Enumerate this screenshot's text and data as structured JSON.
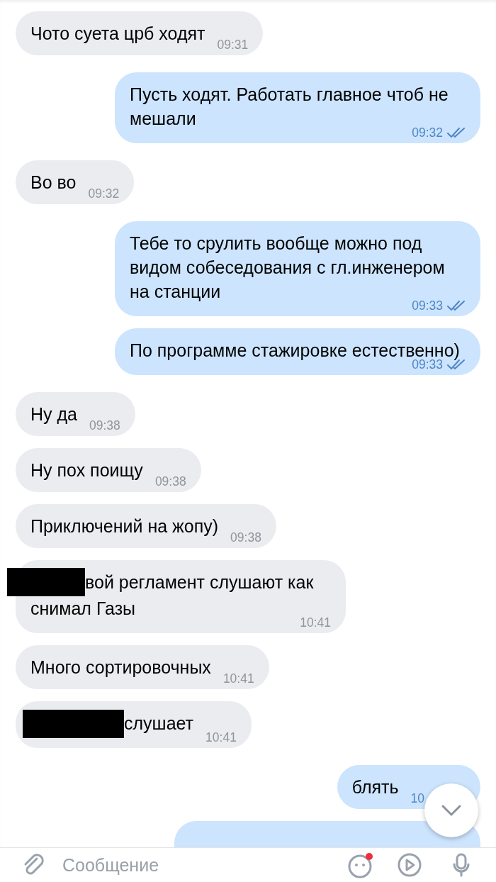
{
  "messages": [
    {
      "outgoing": false,
      "text": "Чото суета црб ходят",
      "time": "09:31"
    },
    {
      "outgoing": true,
      "text": "Пусть ходят. Работать главное чтоб не мешали",
      "time": "09:32",
      "read": true
    },
    {
      "outgoing": false,
      "text": "Во во",
      "time": "09:32"
    },
    {
      "outgoing": true,
      "text": "Тебе то срулить вообще можно под видом собеседования с гл.инженером на станции",
      "time": "09:33",
      "read": true
    },
    {
      "outgoing": true,
      "text": "По программе стажировке естественно)",
      "time": "09:33",
      "read": true
    },
    {
      "outgoing": false,
      "text": "Ну да",
      "time": "09:38"
    },
    {
      "outgoing": false,
      "text": "Ну пох поищу",
      "time": "09:38"
    },
    {
      "outgoing": false,
      "text": "Приключений на жопу)",
      "time": "09:38"
    },
    {
      "outgoing": false,
      "text": "вой регламент слушают как снимал Газы",
      "time": "10:41",
      "redacted": true
    },
    {
      "outgoing": false,
      "text": "Много сортировочных",
      "time": "10:41"
    },
    {
      "outgoing": false,
      "text": "слушает",
      "time": "10:41",
      "redacted": true
    },
    {
      "outgoing": true,
      "text": "блять",
      "time": "10"
    },
    {
      "outgoing": true,
      "kind": "cut"
    }
  ],
  "composer": {
    "placeholder": "Сообщение",
    "sticker_notification": true
  }
}
